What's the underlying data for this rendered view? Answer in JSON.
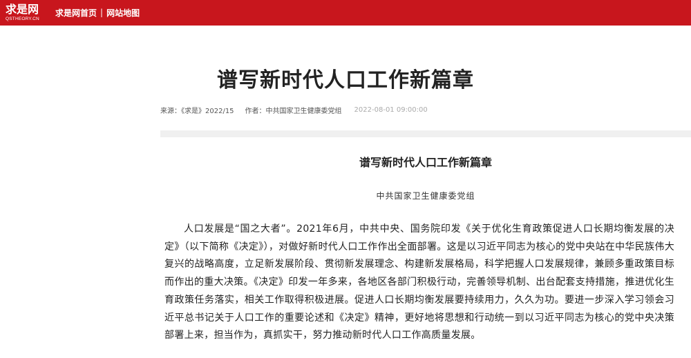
{
  "header": {
    "logo_main": "求是网",
    "logo_sub": "QSTHEORY.CN",
    "nav": [
      {
        "label": "求是网首页"
      },
      {
        "label": "网站地图"
      }
    ],
    "separator": "|",
    "background_color": "#c8161d"
  },
  "article": {
    "title": "谱写新时代人口工作新篇章",
    "meta": {
      "source": "来源：《求是》2022/15",
      "author": "作者：中共国家卫生健康委党组",
      "date": "2022-08-01 09:00:00"
    },
    "sub_title": "谱写新时代人口工作新篇章",
    "sub_author": "中共国家卫生健康委党组",
    "paragraph": "人口发展是“国之大者”。2021年6月，中共中央、国务院印发《关于优化生育政策促进人口长期均衡发展的决定》（以下简称《决定》），对做好新时代人口工作作出全面部署。这是以习近平同志为核心的党中央站在中华民族伟大复兴的战略高度，立足新发展阶段、贯彻新发展理念、构建新发展格局，科学把握人口发展规律，兼顾多重政策目标而作出的重大决策。《决定》印发一年多来，各地区各部门积极行动，完善领导机制、出台配套支持措施，推进优化生育政策任务落实，相关工作取得积极进展。促进人口长期均衡发展要持续用力，久久为功。要进一步深入学习领会习近平总书记关于人口工作的重要论述和《决定》精神，更好地将思想和行动统一到以习近平同志为核心的党中央决策部署上来，担当作为，真抓实干，努力推动新时代人口工作高质量发展。"
  }
}
